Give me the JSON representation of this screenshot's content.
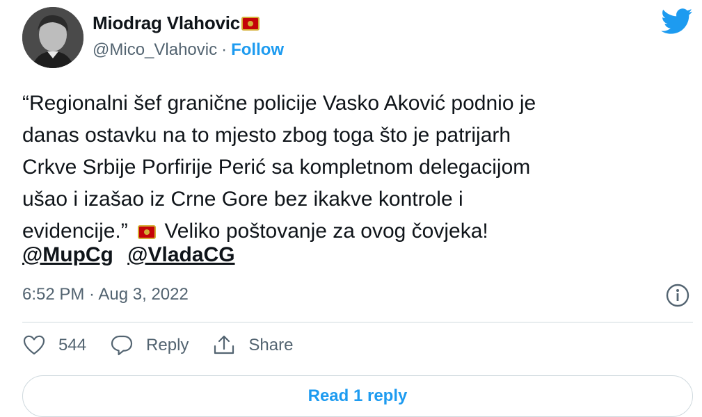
{
  "user": {
    "name": "Miodrag Vlahovic",
    "handle": "@Mico_Vlahovic",
    "separator": "·",
    "follow_label": "Follow",
    "flag_icon": "montenegro-flag-icon"
  },
  "tweet": {
    "lines": [
      "“Regionalni šef granične policije Vasko Aković podnio je",
      "danas ostavku na to mjesto zbog toga što je patrijarh",
      "Crkve Srbije Porfirije Perić sa kompletnom delegacijom",
      "ušao i izašao iz Crne Gore bez ikakve kontrole i",
      "evidencije.”",
      " Veliko poštovanje za ovog čovjeka!"
    ],
    "mentions": [
      "@MupCg",
      "@VladaCG"
    ],
    "timestamp": "6:52 PM · Aug 3, 2022"
  },
  "actions": {
    "likes_count": "544",
    "reply_label": "Reply",
    "share_label": "Share"
  },
  "footer": {
    "read_reply_label": "Read 1 reply"
  },
  "colors": {
    "accent": "#1d9bf0",
    "text": "#0f1419",
    "secondary": "#536471",
    "border": "#cfd9de",
    "flag_red": "#c40308",
    "flag_gold": "#d4af37"
  }
}
